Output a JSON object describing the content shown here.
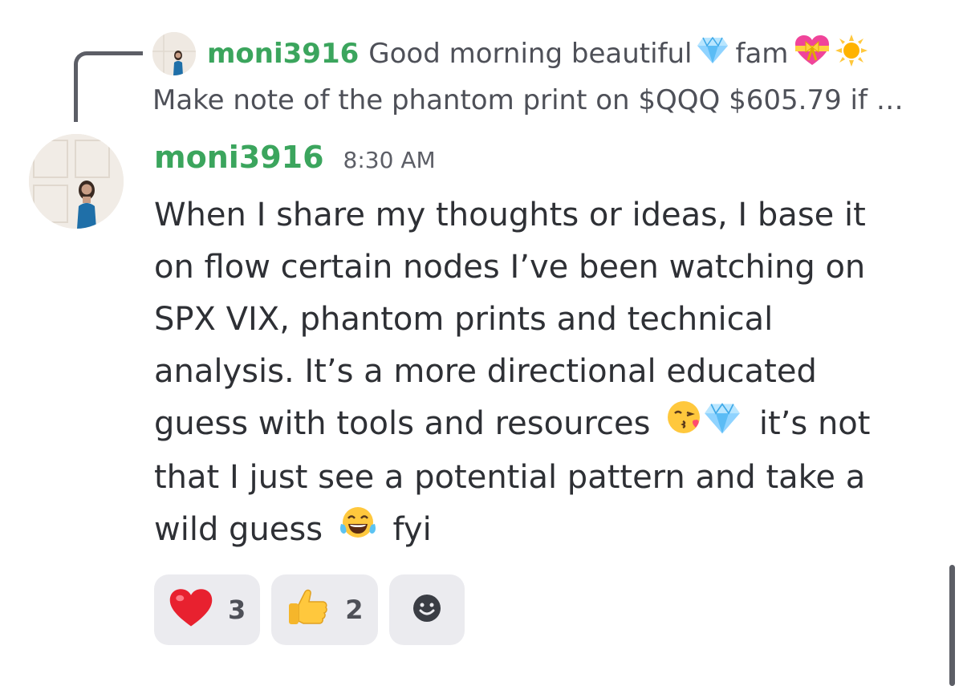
{
  "reply": {
    "author": "moni3916",
    "text_part1": "Good morning beautiful",
    "text_part2": "fam",
    "line2": "Make note of the phantom print on $QQQ $605.79 if …",
    "icons": [
      "gem-icon",
      "heart-with-ribbon-icon",
      "sun-icon"
    ]
  },
  "message": {
    "author": "moni3916",
    "timestamp": "8:30 AM",
    "lines": [
      "When I share my thoughts or ideas, I base it",
      "on flow certain nodes I’ve been watching on",
      "SPX VIX, phantom prints and technical",
      "analysis. It’s a more directional educated"
    ],
    "line5_text1": "guess with tools and resources",
    "line5_text2": "it’s not",
    "line6": "that I just see a potential pattern and take a",
    "line7_text1": "wild guess",
    "line7_text2": "fyi",
    "inline_icons": [
      "kissing-face-icon",
      "gem-icon",
      "laughing-tears-icon"
    ]
  },
  "reactions": [
    {
      "icon": "red-heart-icon",
      "count": "3"
    },
    {
      "icon": "thumbs-up-icon",
      "count": "2"
    },
    {
      "icon": "add-reaction-icon"
    }
  ],
  "colors": {
    "author": "#3ba55d",
    "text": "#2e3035",
    "muted": "#5c5e66",
    "reaction_bg": "#ebebef",
    "background": "#ffffff"
  }
}
